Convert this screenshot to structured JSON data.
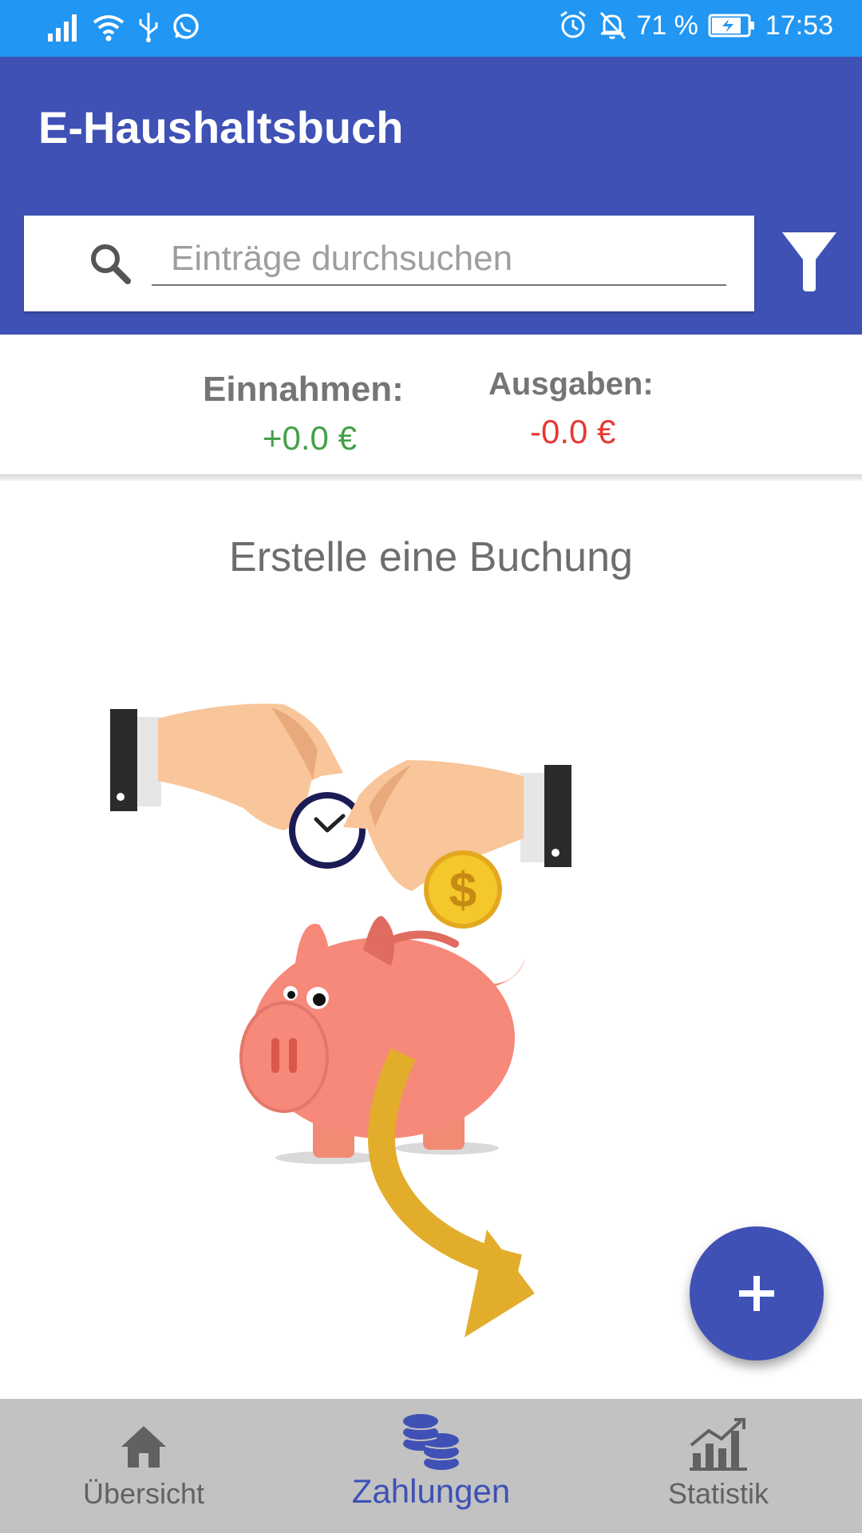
{
  "status_bar": {
    "battery": "71 %",
    "time": "17:53",
    "icons": [
      "signal-icon",
      "wifi-icon",
      "usb-icon",
      "whatsapp-icon",
      "alarm-icon",
      "notifications-off-icon",
      "battery-charging-icon"
    ]
  },
  "app_bar": {
    "title": "E-Haushaltsbuch"
  },
  "search": {
    "placeholder": "Einträge durchsuchen",
    "value": ""
  },
  "summary": {
    "income_label": "Einnahmen:",
    "income_value": "+0.0 €",
    "expense_label": "Ausgaben:",
    "expense_value": "-0.0 €"
  },
  "empty_state": {
    "message": "Erstelle eine Buchung"
  },
  "fab": {
    "icon": "plus-icon"
  },
  "bottom_nav": {
    "items": [
      {
        "label": "Übersicht",
        "icon": "home-icon",
        "active": false
      },
      {
        "label": "Zahlungen",
        "icon": "coins-icon",
        "active": true
      },
      {
        "label": "Statistik",
        "icon": "bar-chart-icon",
        "active": false
      }
    ]
  },
  "colors": {
    "status_bar": "#2196F3",
    "primary": "#3F51B5",
    "income": "#43A047",
    "expense": "#E53935",
    "nav_background": "#C2C2C2",
    "nav_inactive": "#616161"
  }
}
